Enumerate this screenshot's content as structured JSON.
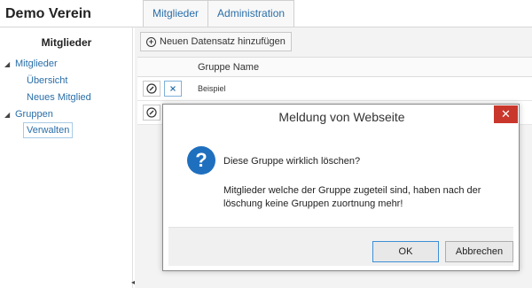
{
  "app": {
    "title": "Demo Verein"
  },
  "tabs": [
    {
      "label": "Mitglieder"
    },
    {
      "label": "Administration"
    }
  ],
  "sidebar": {
    "heading": "Mitglieder",
    "tree": [
      {
        "label": "Mitglieder",
        "expanded": true,
        "children": [
          {
            "label": "Übersicht"
          },
          {
            "label": "Neues Mitglied"
          }
        ]
      },
      {
        "label": "Gruppen",
        "expanded": true,
        "children": [
          {
            "label": "Verwalten",
            "selected": true
          }
        ]
      }
    ],
    "arrow_glyph": "◢",
    "collapse_glyph": "◀"
  },
  "main": {
    "add_button_label": "Neuen Datensatz hinzufügen",
    "table": {
      "columns": [
        "Gruppe Name"
      ],
      "rows": [
        {
          "name": "Beispiel"
        },
        {
          "name": ""
        }
      ]
    }
  },
  "dialog": {
    "title": "Meldung von Webseite",
    "close_glyph": "✕",
    "icon_glyph": "?",
    "message_line1": "Diese Gruppe wirklich löschen?",
    "message_line2": "Mitglieder welche der Gruppe zugeteil sind, haben nach der löschung keine Gruppen zuortnung mehr!",
    "ok_label": "OK",
    "cancel_label": "Abbrechen"
  },
  "colors": {
    "accent": "#2a6ea8",
    "close_red": "#c9372c",
    "question_blue": "#1f6fbf"
  }
}
